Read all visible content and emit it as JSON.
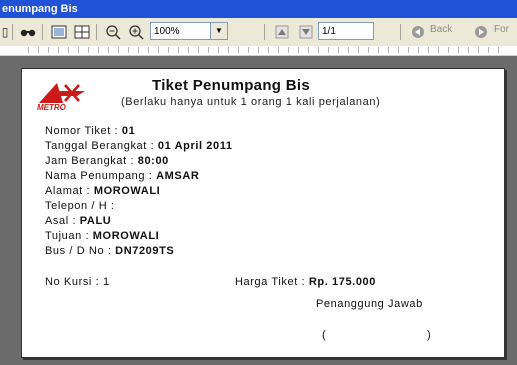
{
  "window": {
    "title": "enumpang Bis"
  },
  "toolbar": {
    "zoom": "100%",
    "page": "1/1",
    "back_label": "Back",
    "forward_label": "For"
  },
  "ticket": {
    "logo_text": "METRO",
    "title": "Tiket Penumpang Bis",
    "subtitle": "(Berlaku hanya untuk 1 orang 1 kali perjalanan)",
    "rows": [
      {
        "label": "Nomor Tiket : ",
        "value": "01"
      },
      {
        "label": "Tanggal Berangkat : ",
        "value": "01 April 2011"
      },
      {
        "label": "Jam Berangkat : ",
        "value": "80:00"
      },
      {
        "label": "Nama Penumpang : ",
        "value": "AMSAR"
      },
      {
        "label": "Alamat : ",
        "value": "MOROWALI"
      },
      {
        "label": "Telepon / H : ",
        "value": ""
      },
      {
        "label": "Asal : ",
        "value": "PALU"
      },
      {
        "label": "Tujuan : ",
        "value": "MOROWALI"
      },
      {
        "label": "Bus / D No : ",
        "value": "DN7209TS"
      },
      {
        "label": "No Kursi : ",
        "value": "1"
      }
    ],
    "price_label": "Harga Tiket : ",
    "price_value": "Rp. 175.000",
    "signature_label": "Penanggung Jawab",
    "paren_open": "(",
    "paren_close": ")"
  },
  "colors": {
    "titlebar": "#1f52d6",
    "toolbar": "#ece9d8",
    "workspace": "#6b6b6b",
    "logo_red": "#cc1a1a"
  }
}
